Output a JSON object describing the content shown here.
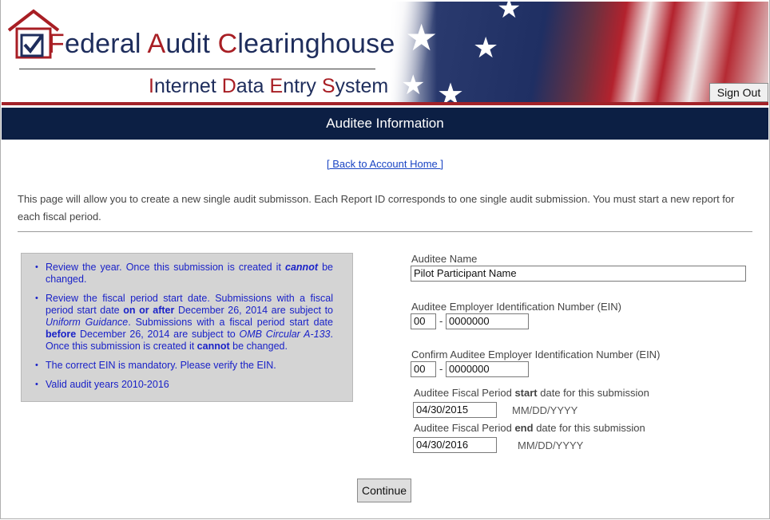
{
  "header": {
    "title_parts": [
      {
        "cap": "F",
        "rest": "ederal "
      },
      {
        "cap": "A",
        "rest": "udit "
      },
      {
        "cap": "C",
        "rest": "learinghouse"
      }
    ],
    "subtitle_parts": [
      {
        "cap": "I",
        "rest": "nternet "
      },
      {
        "cap": "D",
        "rest": "ata "
      },
      {
        "cap": "E",
        "rest": "ntry "
      },
      {
        "cap": "S",
        "rest": "ystem"
      }
    ],
    "sign_out_label": "Sign Out"
  },
  "banner": {
    "title": "Auditee Information"
  },
  "back_link": "[ Back to Account Home ]",
  "intro_text": "This page will allow you to create a new single audit submisson. Each Report ID corresponds to one single audit submission. You must start a new report for each fiscal period.",
  "notes": {
    "item1_a": "Review the year. Once this submission is created it ",
    "item1_b": "cannot",
    "item1_c": " be changed.",
    "item2_a": "Review the fiscal period start date. Submissions with a fiscal period start date ",
    "item2_b": "on or after",
    "item2_c": " December 26, 2014 are subject to ",
    "item2_d": "Uniform Guidance",
    "item2_e": ". Submissions with a fiscal period start date ",
    "item2_f": "before",
    "item2_g": " December 26, 2014 are subject to ",
    "item2_h": "OMB Circular A-133",
    "item2_i": ". Once this submission is created it ",
    "item2_j": "cannot",
    "item2_k": " be changed.",
    "item3": "The correct EIN is mandatory. Please verify the EIN.",
    "item4": "Valid audit years 2010-2016"
  },
  "form": {
    "auditee_name_label": "Auditee Name",
    "auditee_name_value": "Pilot Participant Name",
    "ein_label": "Auditee Employer Identification Number (EIN)",
    "ein_prefix": "00",
    "ein_suffix": "0000000",
    "confirm_ein_label": "Confirm Auditee Employer Identification Number (EIN)",
    "confirm_ein_prefix": "00",
    "confirm_ein_suffix": "0000000",
    "dash": "-",
    "start_label_a": "Auditee Fiscal Period ",
    "start_label_b": "start",
    "start_label_c": " date for this submission",
    "start_value": "04/30/2015",
    "end_label_a": "Auditee Fiscal Period ",
    "end_label_b": "end",
    "end_label_c": " date for this submission",
    "end_value": "04/30/2016",
    "date_format": "MM/DD/YYYY",
    "continue_label": "Continue"
  },
  "colors": {
    "brand_navy": "#0c1f44",
    "brand_red": "#a32228",
    "note_blue": "#1a22c8",
    "link_blue": "#1a45c4"
  }
}
